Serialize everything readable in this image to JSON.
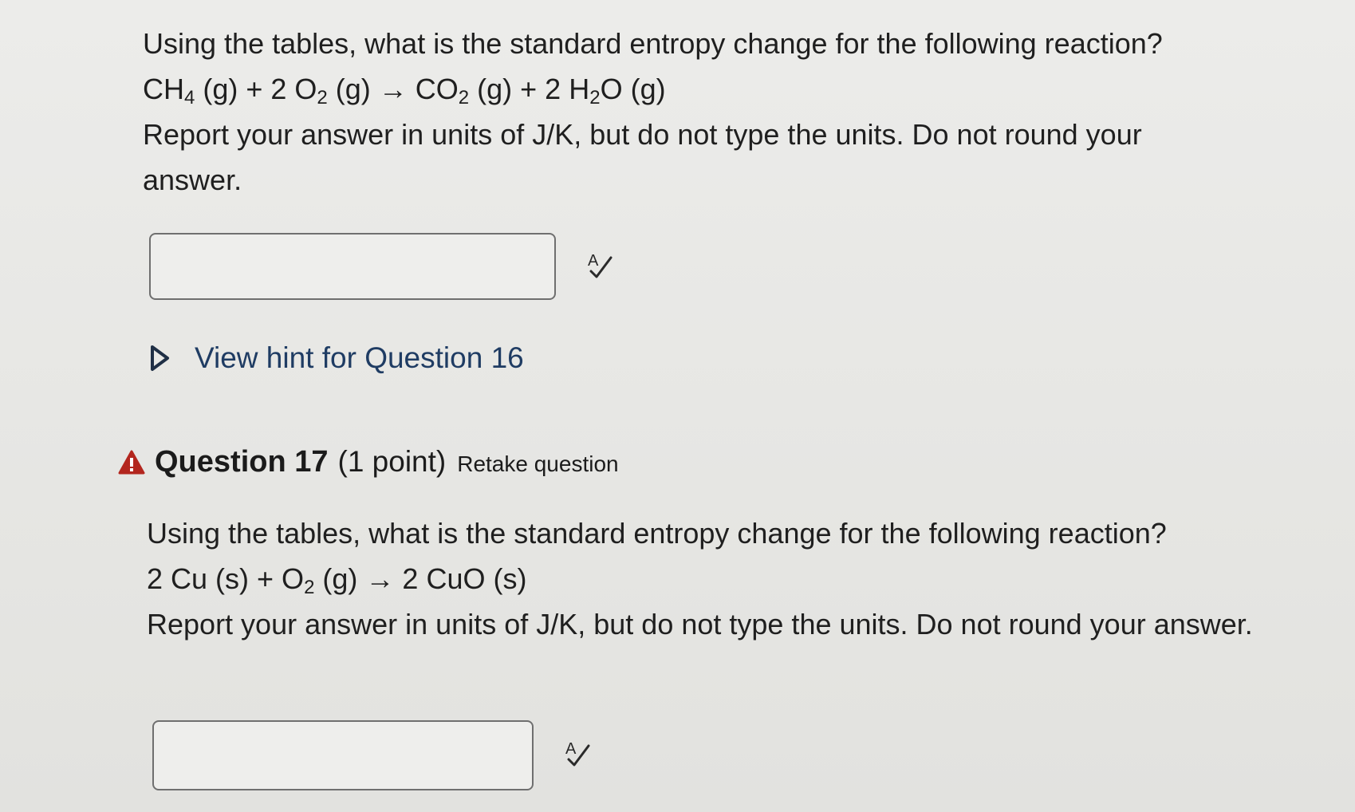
{
  "question16": {
    "prompt": "Using the tables, what is the standard entropy change for the following reaction?",
    "reaction": {
      "r1_coef": "",
      "r1": "CH",
      "r1_sub": "4",
      "r1_state": " (g) + 2 O",
      "r2_sub": "2",
      "r2_state": " (g) → CO",
      "p1_sub": "2",
      "p1_state": " (g) + 2 H",
      "p2_sub": "2",
      "p2_state": "O (g)"
    },
    "instruction": "Report your answer in units of J/K, but do not type the units. Do not round your answer.",
    "answer_value": "",
    "hint_label": "View hint for Question 16"
  },
  "question17": {
    "title": "Question 17",
    "points": "(1 point)",
    "retake_label": "Retake question",
    "prompt": "Using the tables, what is the standard entropy change for the following reaction?",
    "reaction": {
      "part1": "2 Cu (s) + O",
      "sub1": "2",
      "part2": " (g) → 2 CuO (s)"
    },
    "instruction": "Report your answer in units of J/K, but do not type the units. Do not round your answer.",
    "answer_value": ""
  },
  "icons": {
    "spellcheck": "spellcheck-icon",
    "hint_toggle": "triangle-right-icon",
    "warning": "warning-icon"
  },
  "colors": {
    "hint_link": "#1f3c63",
    "warning": "#b3261e",
    "box_border": "#6f6f6f"
  }
}
